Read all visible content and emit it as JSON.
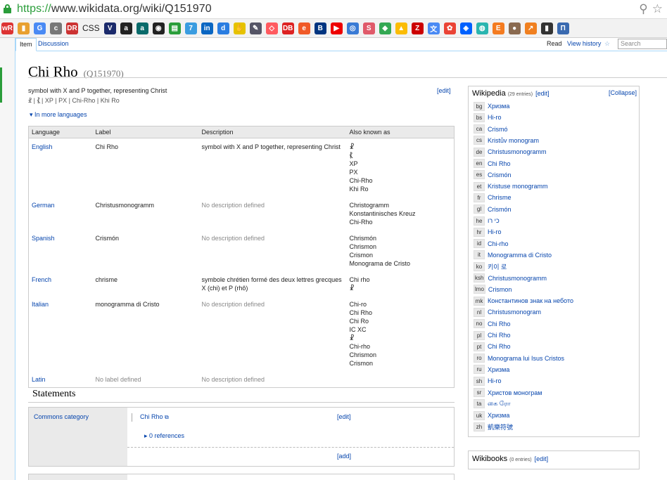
{
  "browser": {
    "url_scheme": "https://",
    "url_rest": "www.wikidata.org/wiki/Q151970",
    "bookmarks": [
      {
        "name": "WR",
        "color": "#d33",
        "text": "wR"
      },
      {
        "name": "chart",
        "color": "#e8a030",
        "text": "▮"
      },
      {
        "name": "translate",
        "color": "#4a8af4",
        "text": "G"
      },
      {
        "name": "c",
        "color": "#777",
        "text": "c"
      },
      {
        "name": "dr",
        "color": "#c33",
        "text": "DR"
      },
      {
        "name": "css",
        "color": "",
        "text": "CSS"
      },
      {
        "name": "v",
        "color": "#1b2a6b",
        "text": "V"
      },
      {
        "name": "amazon",
        "color": "#222",
        "text": "a"
      },
      {
        "name": "a2",
        "color": "#0a6b6b",
        "text": "a"
      },
      {
        "name": "github",
        "color": "#222",
        "text": "◉"
      },
      {
        "name": "trello",
        "color": "#2a9d3a",
        "text": "▤"
      },
      {
        "name": "t7",
        "color": "#3a9ce0",
        "text": "7"
      },
      {
        "name": "linkedin",
        "color": "#0a66c2",
        "text": "in"
      },
      {
        "name": "d",
        "color": "#2a7de1",
        "text": "d"
      },
      {
        "name": "hand",
        "color": "#e6c200",
        "text": "✋"
      },
      {
        "name": "feather",
        "color": "#556",
        "text": "✎"
      },
      {
        "name": "airbnb",
        "color": "#ff5a5f",
        "text": "◇"
      },
      {
        "name": "db",
        "color": "#d22",
        "text": "DB"
      },
      {
        "name": "e",
        "color": "#f05a28",
        "text": "e"
      },
      {
        "name": "booking",
        "color": "#003580",
        "text": "B"
      },
      {
        "name": "youtube",
        "color": "#e00",
        "text": "▶"
      },
      {
        "name": "target",
        "color": "#3a7bd5",
        "text": "◎"
      },
      {
        "name": "s",
        "color": "#e05a6a",
        "text": "S"
      },
      {
        "name": "maps",
        "color": "#34a853",
        "text": "◆"
      },
      {
        "name": "drive",
        "color": "#fbbc04",
        "text": "▲"
      },
      {
        "name": "z",
        "color": "#c00",
        "text": "Z"
      },
      {
        "name": "gtranslate",
        "color": "#4a8af4",
        "text": "文"
      },
      {
        "name": "photos",
        "color": "#ea4335",
        "text": "✿"
      },
      {
        "name": "dropbox",
        "color": "#0061fe",
        "text": "◈"
      },
      {
        "name": "spiral",
        "color": "#2bb5b0",
        "text": "◍"
      },
      {
        "name": "e2",
        "color": "#f47b20",
        "text": "E"
      },
      {
        "name": "avatar",
        "color": "#8a6a50",
        "text": "●"
      },
      {
        "name": "trend",
        "color": "#f08020",
        "text": "↗"
      },
      {
        "name": "print",
        "color": "#333",
        "text": "▮"
      },
      {
        "name": "pi",
        "color": "#3a6ab0",
        "text": "П"
      }
    ]
  },
  "tabs": {
    "item": "Item",
    "discussion": "Discussion",
    "read": "Read",
    "view_history": "View history",
    "search_placeholder": "Search"
  },
  "entity": {
    "label": "Chi Rho",
    "qid": "(Q151970)",
    "description": "symbol with X and P together, representing Christ",
    "aliases": "☧ | ⳩ | XP | PX | Chi-Rho | Khi Ro",
    "edit": "[edit]",
    "more_languages": "▾ In more languages"
  },
  "lang_table": {
    "headers": [
      "Language",
      "Label",
      "Description",
      "Also known as"
    ],
    "rows": [
      {
        "lang": "English",
        "label": "Chi Rho",
        "label_muted": false,
        "desc": "symbol with X and P together, representing Christ",
        "desc_muted": false,
        "aka": "☧\n⳩\nXP\nPX\nChi-Rho\nKhi Ro"
      },
      {
        "lang": "German",
        "label": "Christusmonogramm",
        "label_muted": false,
        "desc": "No description defined",
        "desc_muted": true,
        "aka": "Christogramm\nKonstantinisches Kreuz\nChi-Rho"
      },
      {
        "lang": "Spanish",
        "label": "Crismón",
        "label_muted": false,
        "desc": "No description defined",
        "desc_muted": true,
        "aka": "Chrismón\nChrismon\nCrismon\nMonograma de Cristo"
      },
      {
        "lang": "French",
        "label": "chrisme",
        "label_muted": false,
        "desc": "symbole chrétien formé des deux lettres grecques X (chi) et P (rhô)",
        "desc_muted": false,
        "aka": "Chi rho\n☧"
      },
      {
        "lang": "Italian",
        "label": "monogramma di Cristo",
        "label_muted": false,
        "desc": "No description defined",
        "desc_muted": true,
        "aka": "Chi-ro\nChi Rho\nChi Ro\nIC XC\n☧\nChi-rho\nChrismon\nCrismon"
      },
      {
        "lang": "Latin",
        "label": "No label defined",
        "label_muted": true,
        "desc": "No description defined",
        "desc_muted": true,
        "aka": ""
      }
    ]
  },
  "statements": {
    "heading": "Statements",
    "property": "Commons category",
    "value": "Chi Rho",
    "value_edit": "[edit]",
    "references": "▸ 0 references",
    "add": "[add]"
  },
  "wikipedia": {
    "title": "Wikipedia",
    "count": "(29 entries)",
    "edit": "[edit]",
    "collapse": "[Collapse]",
    "links": [
      {
        "code": "bg",
        "title": "Хризма"
      },
      {
        "code": "bs",
        "title": "Hi-ro"
      },
      {
        "code": "ca",
        "title": "Crismó"
      },
      {
        "code": "cs",
        "title": "Kristův monogram"
      },
      {
        "code": "de",
        "title": "Christusmonogramm"
      },
      {
        "code": "en",
        "title": "Chi Rho"
      },
      {
        "code": "es",
        "title": "Crismón"
      },
      {
        "code": "et",
        "title": "Kristuse monogramm"
      },
      {
        "code": "fr",
        "title": "Chrisme"
      },
      {
        "code": "gl",
        "title": "Crismón"
      },
      {
        "code": "he",
        "title": "כי רו"
      },
      {
        "code": "hr",
        "title": "Hi-ro"
      },
      {
        "code": "id",
        "title": "Chi-rho"
      },
      {
        "code": "it",
        "title": "Monogramma di Cristo"
      },
      {
        "code": "ko",
        "title": "키이 로"
      },
      {
        "code": "ksh",
        "title": "Christusmonogramm"
      },
      {
        "code": "lmo",
        "title": "Crismon"
      },
      {
        "code": "mk",
        "title": "Константинов знак на небото"
      },
      {
        "code": "nl",
        "title": "Christusmonogram"
      },
      {
        "code": "no",
        "title": "Chi Rho"
      },
      {
        "code": "pl",
        "title": "Chi Rho"
      },
      {
        "code": "pt",
        "title": "Chi Rho"
      },
      {
        "code": "ro",
        "title": "Monograma lui Isus Cristos"
      },
      {
        "code": "ru",
        "title": "Хризма"
      },
      {
        "code": "sh",
        "title": "Hi-ro"
      },
      {
        "code": "sr",
        "title": "Христов монограм"
      },
      {
        "code": "ta",
        "title": "கை ரோ"
      },
      {
        "code": "uk",
        "title": "Хризма"
      },
      {
        "code": "zh",
        "title": "凱樂符號"
      }
    ]
  },
  "wikibooks": {
    "title": "Wikibooks",
    "count": "(0 entries)",
    "edit": "[edit]"
  }
}
